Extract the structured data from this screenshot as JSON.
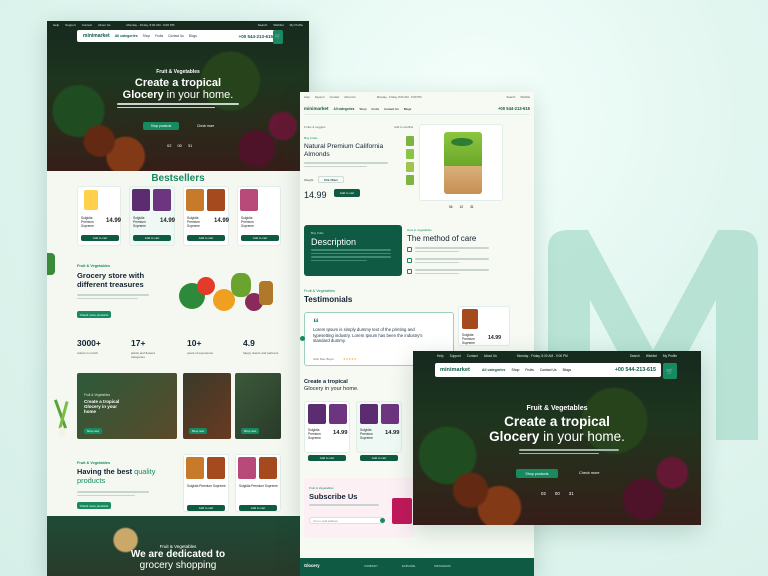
{
  "brand": {
    "logo": "minimarket",
    "accent": "#0f5a43",
    "accent2": "#178a62"
  },
  "nav": {
    "categories": "All categories",
    "links": [
      "Shop",
      "Fruits",
      "Contact Us",
      "Blogs"
    ],
    "phone": "+00 544-213-615",
    "topbar": [
      "Help",
      "Support",
      "Contact",
      "About Us",
      "Monday - Friday, 8:00 AM - 9:00 PM",
      "Search",
      "Wishlist",
      "My Profile"
    ]
  },
  "hero": {
    "kicker": "Fruit & Vegetables",
    "line1": "Create a tropical",
    "line2_bold": "Glocery",
    "line2_rest": " in your home.",
    "shop_button": "Shop products",
    "secondary": "Check more",
    "timer": [
      "02",
      "00",
      "31"
    ]
  },
  "left": {
    "bestsellers": "Bestsellers",
    "products": [
      {
        "name": "Sulgidia Premium Supreme",
        "price": "14.99"
      },
      {
        "name": "Sulgidia Premium Supreme",
        "price": "14.99"
      },
      {
        "name": "Sulgidia Premium Supreme",
        "price": "14.99"
      },
      {
        "name": "Sulgidia Premium Supreme",
        "price": "14.99"
      }
    ],
    "add_cart": "Add to cart",
    "grocery_kicker": "Fruit & Vegetables",
    "grocery_title": "Grocery store with different treasures",
    "grocery_button": "Check more products",
    "stats": [
      {
        "value": "3000+",
        "label": "orders in month"
      },
      {
        "value": "17+",
        "label": "plants and flowers categories"
      },
      {
        "value": "10+",
        "label": "years of experience"
      },
      {
        "value": "4.9",
        "label": "happy clients and partners"
      }
    ],
    "promo_kicker": "Fruit & Vegetables",
    "promo_title": "Create a tropical Glocery in your home",
    "promo_button": "Shop now",
    "quality_kicker": "Fruit & Vegetables",
    "quality_title_bold": "Having the best",
    "quality_title_rest": " quality products",
    "quality_button": "Check more products",
    "footer_kicker": "Fruit & Vegetables",
    "footer_title": "We are dedicated to",
    "footer_title2": "grocery shopping"
  },
  "middle": {
    "breadcrumb": "Fruits & veggies",
    "stock": "Add to wishlist",
    "kicker": "Buy Fruits",
    "product_title": "Natural Premium California Almonds",
    "weight_label": "Weight",
    "weight_value": "Pick Offers",
    "price": "14.99",
    "add_cart": "Add to cart",
    "timer": [
      "04",
      "12",
      "31"
    ],
    "desc_kicker": "Buy fruits",
    "desc_title": "Description",
    "care_kicker": "How to vegetables",
    "care_title": "The method of care",
    "testi_kicker": "Fruit & Vegetables",
    "testi_title": "Testimonials",
    "quote": "Lorem Ipsum is simply dummy text of the printing and typesetting industry. Lorem Ipsum has been the industry's standard dummy.",
    "quote_author": "John Doe, Buyer",
    "testi_product_price": "14.99",
    "create_title": "Create a tropical",
    "create_title2": "Glocery in your home.",
    "products": [
      {
        "name": "Sulgidia Premium Supreme",
        "price": "14.99"
      },
      {
        "name": "Sulgidia Premium Supreme",
        "price": "14.99"
      }
    ],
    "subscribe_kicker": "Fruit & Vegetables",
    "subscribe_title": "Subscribe Us",
    "email_placeholder": "Your e-mail address",
    "footer_logo": "Glocery",
    "footer_cols": [
      "COMPANY",
      "EXPLORE",
      "INSTAGRAM"
    ]
  }
}
